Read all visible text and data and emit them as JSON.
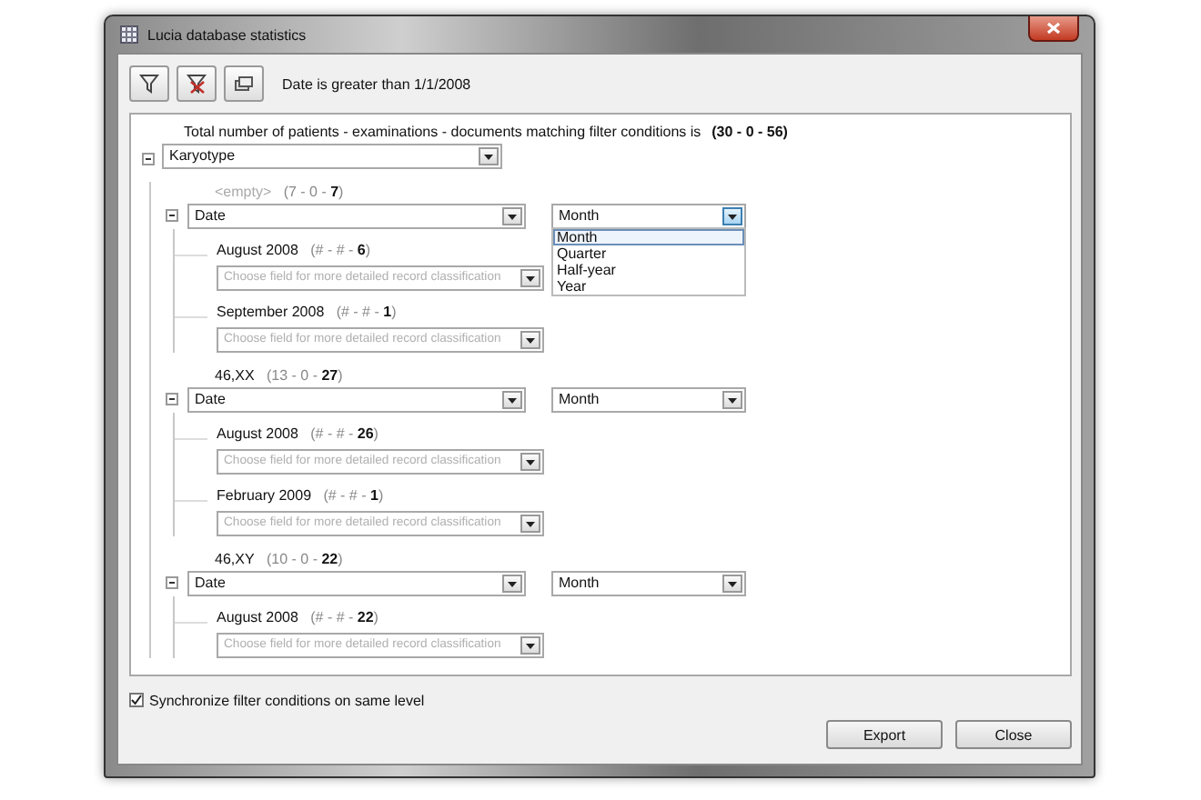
{
  "window": {
    "title": "Lucia database statistics"
  },
  "toolbar": {
    "filter_text": "Date is greater than 1/1/2008"
  },
  "summary": {
    "text": "Total number of patients - examinations - documents matching filter conditions is",
    "counts": "(30 - 0 - 56)"
  },
  "field": {
    "value": "Karyotype"
  },
  "groups": [
    {
      "label": "<empty>",
      "muted": true,
      "counts": "(7 - 0 - **7**)",
      "field": "Date",
      "period": "Month",
      "open": true,
      "options": [
        {
          "label": "Month",
          "selected": true
        },
        {
          "label": "Quarter",
          "selected": false
        },
        {
          "label": "Half-year",
          "selected": false
        },
        {
          "label": "Year",
          "selected": false
        }
      ],
      "children": [
        {
          "label": "August 2008",
          "counts": "(# - # - **6**)",
          "placeholder": "Choose field for more detailed record classification"
        },
        {
          "label": "September 2008",
          "counts": "(# - # - **1**)",
          "placeholder": "Choose field for more detailed record classification"
        }
      ]
    },
    {
      "label": "46,XX",
      "muted": false,
      "counts": "(13 - 0 - **27**)",
      "field": "Date",
      "period": "Month",
      "open": false,
      "children": [
        {
          "label": "August 2008",
          "counts": "(# - # - **26**)",
          "placeholder": "Choose field for more detailed record classification"
        },
        {
          "label": "February 2009",
          "counts": "(# - # - **1**)",
          "placeholder": "Choose field for more detailed record classification"
        }
      ]
    },
    {
      "label": "46,XY",
      "muted": false,
      "counts": "(10 - 0 - **22**)",
      "field": "Date",
      "period": "Month",
      "open": false,
      "children": [
        {
          "label": "August 2008",
          "counts": "(# - # - **22**)",
          "placeholder": "Choose field for more detailed record classification"
        }
      ]
    }
  ],
  "sync": {
    "label": "Synchronize filter conditions on same level",
    "checked": true
  },
  "buttons": [
    "Export",
    "Close"
  ]
}
